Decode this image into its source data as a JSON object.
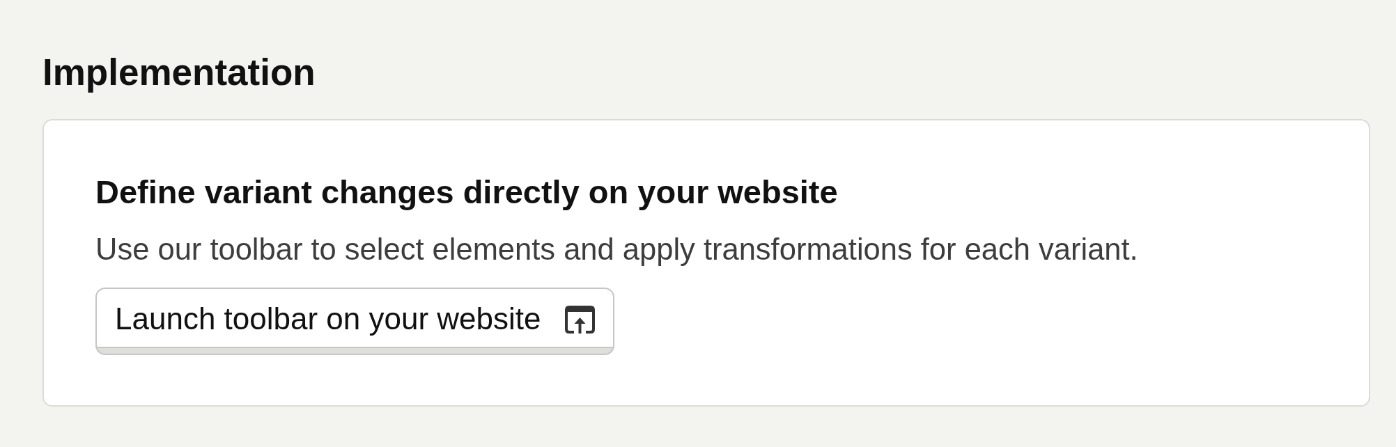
{
  "section": {
    "title": "Implementation"
  },
  "card": {
    "title": "Define variant changes directly on your website",
    "description": "Use our toolbar to select elements and apply transformations for each variant.",
    "button": {
      "label": "Launch toolbar on your website"
    }
  }
}
